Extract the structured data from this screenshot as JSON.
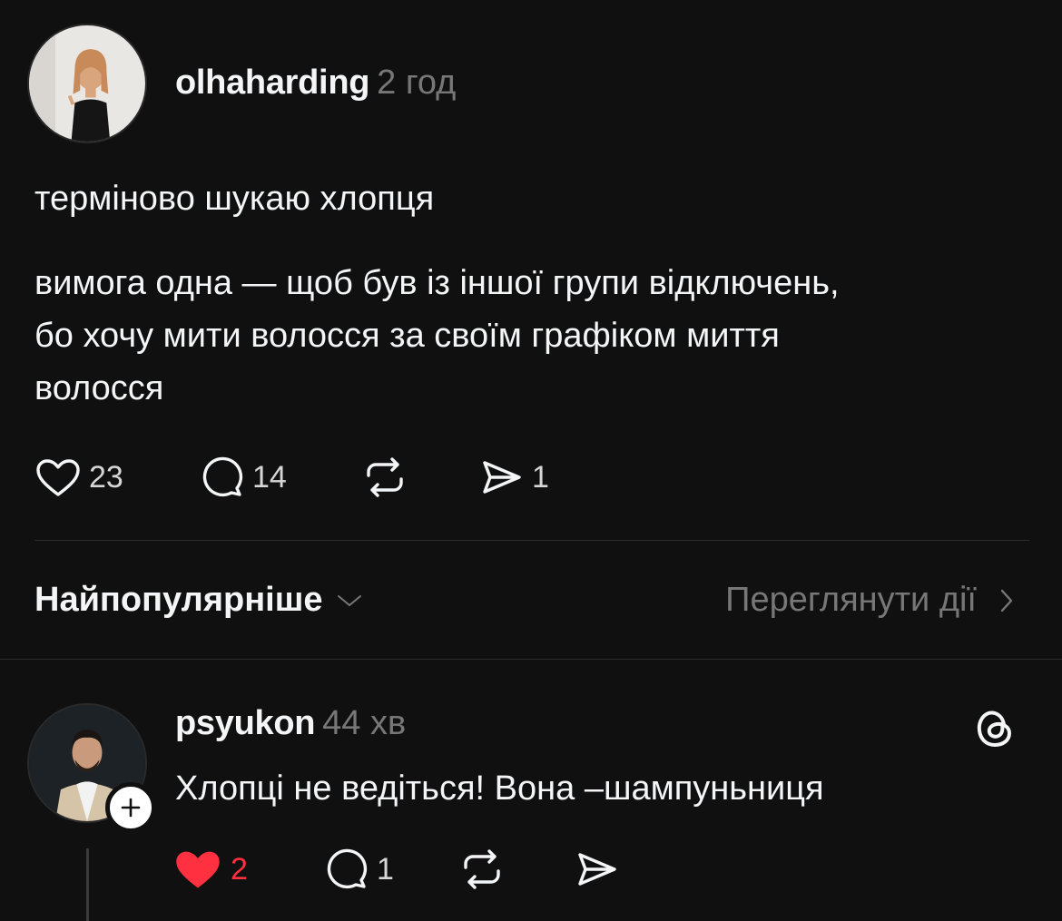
{
  "post": {
    "username": "olhaharding",
    "time": "2 год",
    "paragraph1": "терміново шукаю хлопця",
    "paragraph2_line1": "вимога одна — щоб був із іншої групи відключень,",
    "paragraph2_line2": "бо хочу мити волосся за своїм графіком миття",
    "paragraph2_line3": "волосся",
    "likes": "23",
    "comments": "14",
    "shares": "1"
  },
  "sort": {
    "label": "Найпопулярніше",
    "activity_label": "Переглянути дії"
  },
  "reply": {
    "username": "psyukon",
    "time": "44 хв",
    "text": "Хлопці не ведіться! Вона –шампуньниця",
    "likes": "2",
    "comments": "1",
    "liked": true
  },
  "icons": {
    "like": "heart-icon",
    "comment": "comment-bubble-icon",
    "repost": "repost-icon",
    "share": "send-icon",
    "sort": "chevron-down-icon",
    "activity": "chevron-right-icon",
    "follow": "plus-icon",
    "app": "threads-logo-icon"
  },
  "colors": {
    "background": "#101010",
    "text": "#f3f5f7",
    "secondary": "#777777",
    "like_active": "#ff3040"
  }
}
